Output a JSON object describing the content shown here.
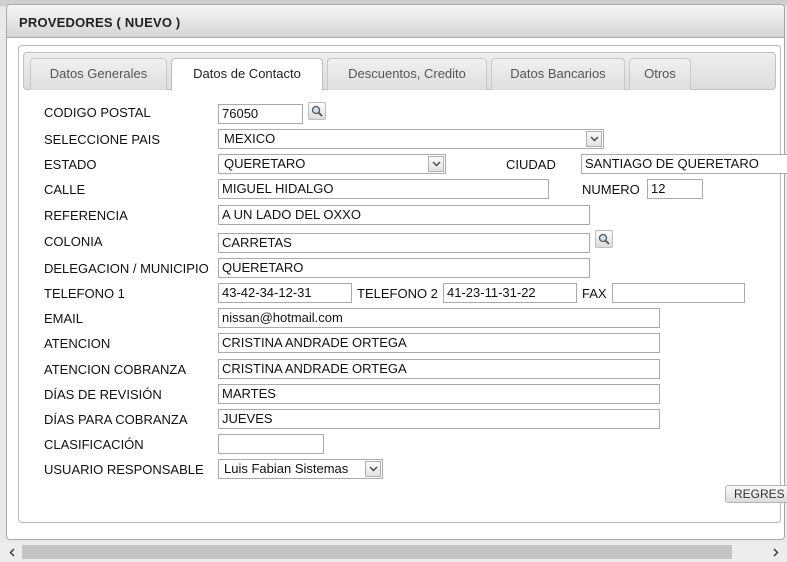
{
  "window": {
    "title": "PROVEDORES ( NUEVO )"
  },
  "tabs": [
    {
      "label": "Datos Generales",
      "active": false
    },
    {
      "label": "Datos de Contacto",
      "active": true
    },
    {
      "label": "Descuentos, Credito",
      "active": false
    },
    {
      "label": "Datos Bancarios",
      "active": false
    },
    {
      "label": "Otros",
      "active": false
    }
  ],
  "form": {
    "codigo_postal": {
      "label": "CODIGO POSTAL",
      "value": "76050"
    },
    "pais": {
      "label": "SELECCIONE PAIS",
      "value": "MEXICO"
    },
    "estado": {
      "label": "ESTADO",
      "value": "QUERETARO"
    },
    "ciudad": {
      "label": "CIUDAD",
      "value": "SANTIAGO DE QUERETARO"
    },
    "calle": {
      "label": "CALLE",
      "value": "MIGUEL HIDALGO"
    },
    "numero": {
      "label": "NUMERO",
      "value": "12"
    },
    "referencia": {
      "label": "REFERENCIA",
      "value": "A UN LADO DEL OXXO"
    },
    "colonia": {
      "label": "COLONIA",
      "value": "CARRETAS"
    },
    "delegacion": {
      "label": "DELEGACION / MUNICIPIO",
      "value": "QUERETARO"
    },
    "telefono1": {
      "label": "TELEFONO 1",
      "value": "43-42-34-12-31"
    },
    "telefono2": {
      "label": "TELEFONO 2",
      "value": "41-23-11-31-22"
    },
    "fax": {
      "label": "FAX",
      "value": ""
    },
    "email": {
      "label": "EMAIL",
      "value": "nissan@hotmail.com"
    },
    "atencion": {
      "label": "ATENCION",
      "value": "CRISTINA ANDRADE ORTEGA"
    },
    "atencion_cobranza": {
      "label": "ATENCION COBRANZA",
      "value": "CRISTINA ANDRADE ORTEGA"
    },
    "dias_revision": {
      "label": "DÍAS DE REVISIÓN",
      "value": "MARTES"
    },
    "dias_cobranza": {
      "label": "DÍAS PARA COBRANZA",
      "value": "JUEVES"
    },
    "clasificacion": {
      "label": "CLASIFICACIÓN",
      "value": ""
    },
    "usuario": {
      "label": "USUARIO RESPONSABLE",
      "value": "Luis Fabian Sistemas"
    }
  },
  "buttons": {
    "regresar": "REGRES"
  },
  "icons": {
    "search": "magnifier-icon",
    "dropdown": "chevron-down-icon",
    "scroll_left": "arrow-left-icon",
    "scroll_right": "arrow-right-icon"
  }
}
